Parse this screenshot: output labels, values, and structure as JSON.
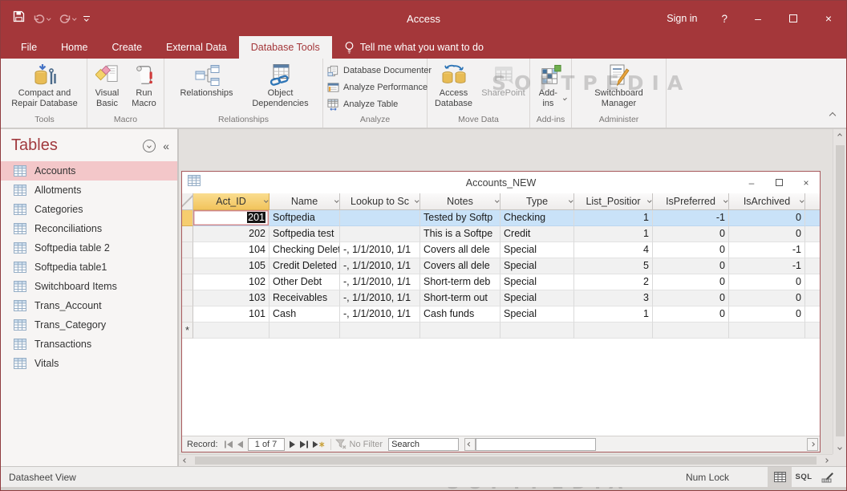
{
  "titlebar": {
    "title": "Access",
    "sign_in": "Sign in",
    "help": "?"
  },
  "window_controls": {
    "minimize": "–",
    "close": "×"
  },
  "tabs": {
    "items": [
      {
        "label": "File",
        "active": false
      },
      {
        "label": "Home",
        "active": false
      },
      {
        "label": "Create",
        "active": false
      },
      {
        "label": "External Data",
        "active": false
      },
      {
        "label": "Database Tools",
        "active": true
      }
    ],
    "tell_me": "Tell me what you want to do"
  },
  "ribbon": {
    "groups": [
      {
        "label": "Tools",
        "buttons": [
          {
            "label": "Compact and Repair Database",
            "icon": "compact-repair-database-icon"
          }
        ]
      },
      {
        "label": "Macro",
        "buttons": [
          {
            "label": "Visual Basic",
            "icon": "visual-basic-icon"
          },
          {
            "label": "Run Macro",
            "icon": "run-macro-icon"
          }
        ]
      },
      {
        "label": "Relationships",
        "buttons": [
          {
            "label": "Relationships",
            "icon": "relationships-icon"
          },
          {
            "label": "Object Dependencies",
            "icon": "object-dependencies-icon"
          }
        ]
      },
      {
        "label": "Analyze",
        "buttons": [
          {
            "label": "Database Documenter",
            "icon": "database-documenter-icon"
          },
          {
            "label": "Analyze Performance",
            "icon": "analyze-performance-icon"
          },
          {
            "label": "Analyze Table",
            "icon": "analyze-table-icon"
          }
        ]
      },
      {
        "label": "Move Data",
        "buttons": [
          {
            "label": "Access Database",
            "icon": "access-database-icon"
          },
          {
            "label": "SharePoint",
            "icon": "sharepoint-icon",
            "disabled": true
          }
        ]
      },
      {
        "label": "Add-ins",
        "buttons": [
          {
            "label": "Add-ins",
            "icon": "add-ins-icon",
            "dropdown": true
          }
        ]
      },
      {
        "label": "Administer",
        "buttons": [
          {
            "label": "Switchboard Manager",
            "icon": "switchboard-manager-icon"
          }
        ]
      }
    ]
  },
  "watermark": "SOFTPEDIA",
  "nav_pane": {
    "title": "Tables",
    "items": [
      {
        "label": "Accounts",
        "selected": true
      },
      {
        "label": "Allotments",
        "selected": false
      },
      {
        "label": "Categories",
        "selected": false
      },
      {
        "label": "Reconciliations",
        "selected": false
      },
      {
        "label": "Softpedia table 2",
        "selected": false
      },
      {
        "label": "Softpedia table1",
        "selected": false
      },
      {
        "label": "Switchboard Items",
        "selected": false
      },
      {
        "label": "Trans_Account",
        "selected": false
      },
      {
        "label": "Trans_Category",
        "selected": false
      },
      {
        "label": "Transactions",
        "selected": false
      },
      {
        "label": "Vitals",
        "selected": false
      }
    ]
  },
  "datasheet": {
    "title": "Accounts_NEW",
    "columns": [
      {
        "label": "Act_ID",
        "selected": true
      },
      {
        "label": "Name",
        "selected": false
      },
      {
        "label": "Lookup to Sc",
        "selected": false
      },
      {
        "label": "Notes",
        "selected": false
      },
      {
        "label": "Type",
        "selected": false
      },
      {
        "label": "List_Positior",
        "selected": false
      },
      {
        "label": "IsPreferred",
        "selected": false
      },
      {
        "label": "IsArchived",
        "selected": false
      }
    ],
    "rows": [
      {
        "act_id": "201",
        "name": "Softpedia",
        "lookup": "",
        "notes": "Tested by Softp",
        "type": "Checking",
        "list_position": "1",
        "is_preferred": "-1",
        "is_archived": "0"
      },
      {
        "act_id": "202",
        "name": "Softpedia test",
        "lookup": "",
        "notes": "This is a Softpe",
        "type": "Credit",
        "list_position": "1",
        "is_preferred": "0",
        "is_archived": "0"
      },
      {
        "act_id": "104",
        "name": "Checking Delet",
        "lookup": "-, 1/1/2010, 1/1",
        "notes": "Covers all dele",
        "type": "Special",
        "list_position": "4",
        "is_preferred": "0",
        "is_archived": "-1"
      },
      {
        "act_id": "105",
        "name": "Credit Deleted",
        "lookup": "-, 1/1/2010, 1/1",
        "notes": "Covers all dele",
        "type": "Special",
        "list_position": "5",
        "is_preferred": "0",
        "is_archived": "-1"
      },
      {
        "act_id": "102",
        "name": "Other Debt",
        "lookup": "-, 1/1/2010, 1/1",
        "notes": "Short-term deb",
        "type": "Special",
        "list_position": "2",
        "is_preferred": "0",
        "is_archived": "0"
      },
      {
        "act_id": "103",
        "name": "Receivables",
        "lookup": "-, 1/1/2010, 1/1",
        "notes": "Short-term out",
        "type": "Special",
        "list_position": "3",
        "is_preferred": "0",
        "is_archived": "0"
      },
      {
        "act_id": "101",
        "name": "Cash",
        "lookup": "-, 1/1/2010, 1/1",
        "notes": "Cash funds",
        "type": "Special",
        "list_position": "1",
        "is_preferred": "0",
        "is_archived": "0"
      }
    ],
    "new_row_marker": "*",
    "record_bar": {
      "record_label": "Record:",
      "position": "1 of 7",
      "no_filter": "No Filter",
      "search": "Search"
    }
  },
  "status_bar": {
    "view_label": "Datasheet View",
    "num_lock": "Num Lock",
    "sql": "SQL"
  },
  "colors": {
    "accent_red": "#A4373A",
    "selected_row": "#C9E2F8",
    "selected_header": "#F6CD6F",
    "nav_selected": "#F3C7C9",
    "window_border": "#A85A5D"
  }
}
